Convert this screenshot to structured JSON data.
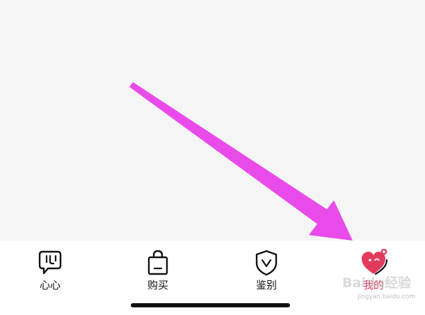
{
  "tab_bar": {
    "items": [
      {
        "label": "心心",
        "icon": "chat-bubble-icon",
        "active": false
      },
      {
        "label": "购买",
        "icon": "shopping-bag-icon",
        "active": false
      },
      {
        "label": "鉴别",
        "icon": "shield-icon",
        "active": false
      },
      {
        "label": "我的",
        "icon": "heart-face-icon",
        "active": true
      }
    ]
  },
  "watermark": {
    "text": "Baidu经验",
    "url": "jingyan.baidu.com"
  },
  "colors": {
    "content_bg": "#f6f5f6",
    "arrow": "#e94bea",
    "active": "#e23a5e",
    "text": "#111111"
  }
}
